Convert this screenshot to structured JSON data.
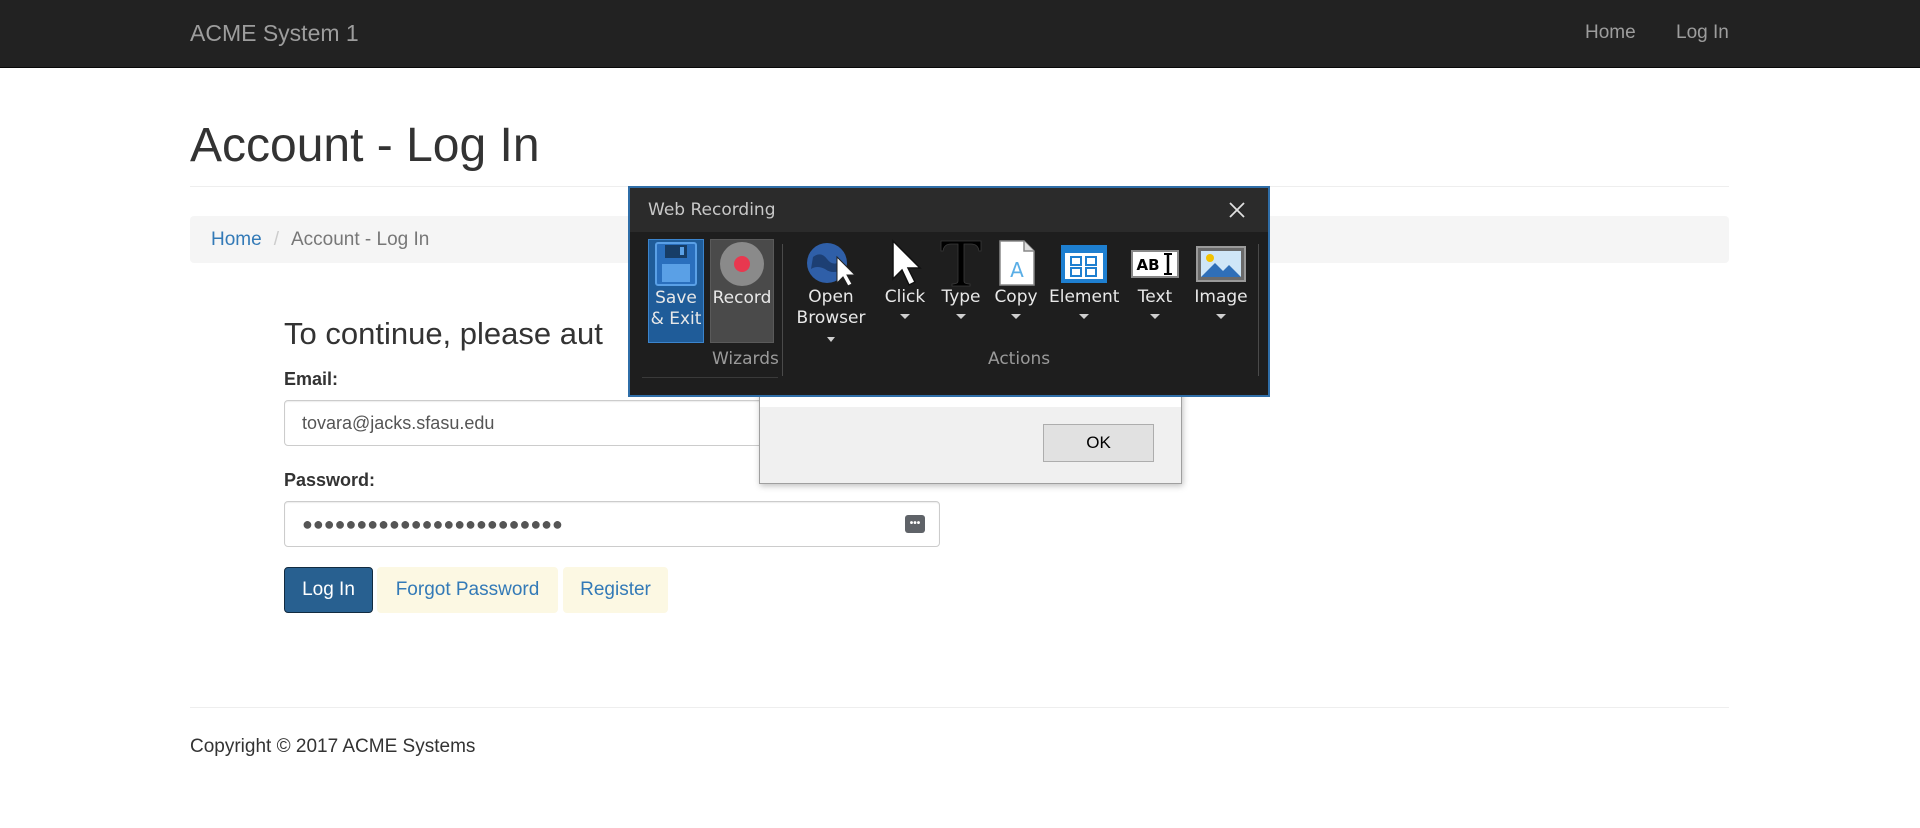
{
  "navbar": {
    "brand": "ACME System 1",
    "links": [
      {
        "label": "Home"
      },
      {
        "label": "Log In"
      }
    ]
  },
  "page": {
    "title": "Account - Log In",
    "breadcrumb": [
      {
        "label": "Home"
      },
      {
        "label": "Account - Log In"
      }
    ]
  },
  "form": {
    "heading": "To continue, please aut",
    "email_label": "Email:",
    "email_value": "tovara@jacks.sfasu.edu",
    "password_label": "Password:",
    "password_value": "●●●●●●●●●●●●●●●●●●●●●●●●",
    "login_button": "Log In",
    "forgot_button": "Forgot Password",
    "register_button": "Register"
  },
  "footer": {
    "copyright": "Copyright © 2017 ACME Systems"
  },
  "message_box": {
    "ok_label": "OK"
  },
  "recorder": {
    "title": "Web Recording",
    "tools": {
      "save": {
        "line1": "Save",
        "line2": "& Exit",
        "icon": "floppy-disk-icon"
      },
      "record": {
        "label": "Record",
        "icon": "record-icon"
      },
      "open": {
        "line1": "Open",
        "line2": "Browser",
        "icon": "globe-cursor-icon"
      },
      "click": {
        "label": "Click",
        "icon": "cursor-icon"
      },
      "type": {
        "label": "Type",
        "icon": "type-t-icon"
      },
      "copy": {
        "label": "Copy",
        "icon": "copy-document-icon"
      },
      "element": {
        "label": "Element",
        "icon": "element-window-icon"
      },
      "text": {
        "label": "Text",
        "icon": "text-abi-icon"
      },
      "image": {
        "label": "Image",
        "icon": "image-icon"
      }
    },
    "groups": {
      "wizards": "Wizards",
      "actions": "Actions"
    },
    "colors": {
      "save_bg": "#1f5c99",
      "record_dot": "#e8384f",
      "window_border": "#2f6ea8"
    }
  }
}
